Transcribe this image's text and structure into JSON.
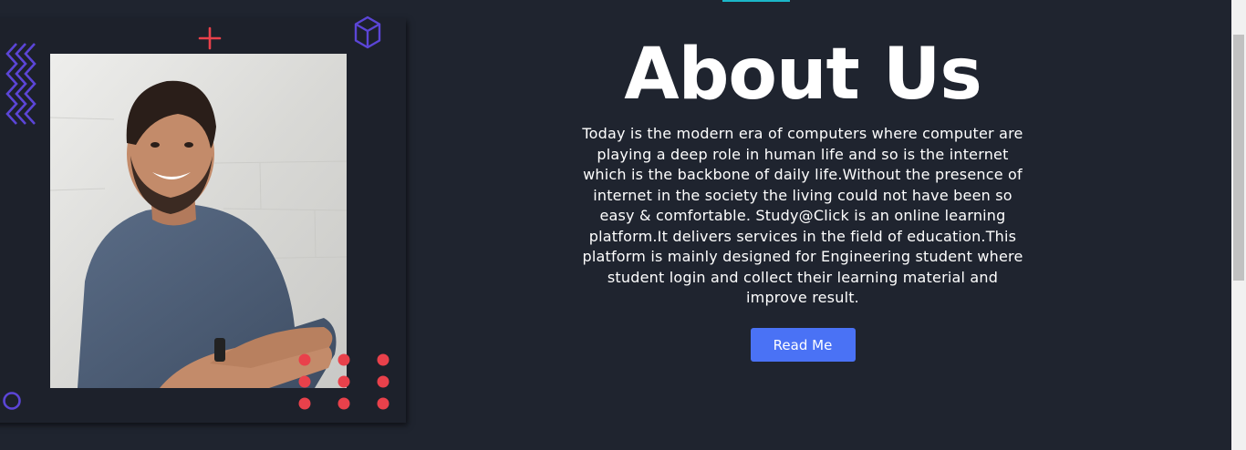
{
  "about": {
    "title": "About Us",
    "description": "Today is the modern era of computers where computer are playing a deep role in human life and so is the internet which is the backbone of daily life.Without the presence of internet in the society the living could not have been so easy & comfortable. Study@Click is an online learning platform.It delivers services in the field of education.This platform is mainly designed for Engineering student where student login and collect their learning material and improve result.",
    "button_label": "Read Me"
  },
  "decorations": {
    "icons": [
      "zigzag-lines-icon",
      "plus-icon",
      "cube-icon",
      "circle-outline-icon",
      "dot-grid-icon"
    ]
  },
  "colors": {
    "background": "#1f242f",
    "card": "#1d212b",
    "accent_button": "#4a72f5",
    "accent_top": "#1bb6c8",
    "decor_purple": "#5b45d6",
    "decor_red": "#e9414b"
  }
}
